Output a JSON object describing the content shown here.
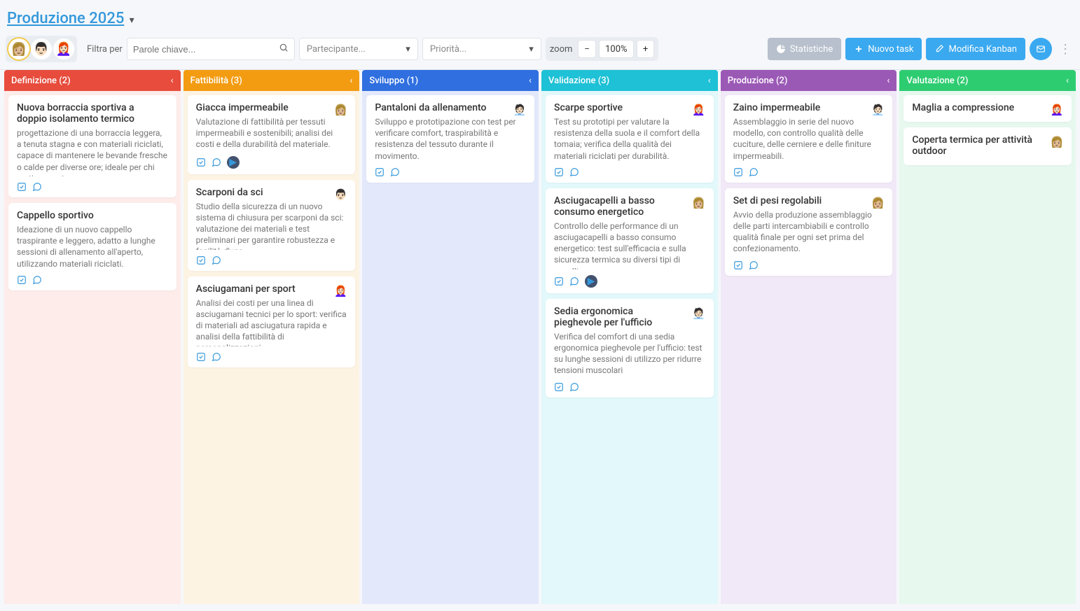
{
  "board_title": "Produzione 2025",
  "toolbar": {
    "filter_label": "Filtra per",
    "keyword_placeholder": "Parole chiave...",
    "participant_placeholder": "Partecipante...",
    "priority_placeholder": "Priorità...",
    "zoom_label": "zoom",
    "zoom_value": "100%",
    "stats_label": "Statistiche",
    "new_task_label": "Nuovo task",
    "edit_kanban_label": "Modifica Kanban"
  },
  "avatars": {
    "top": [
      "blonde-woman",
      "man-short",
      "redhead-woman"
    ]
  },
  "columns": [
    {
      "title": "Definizione (2)",
      "cards": [
        {
          "title": "Nuova borraccia sportiva a doppio isolamento termico",
          "desc": "progettazione di una borraccia leggera, a tenuta stagna e con materiali riciclati, capace di mantenere le bevande fresche o calde per diverse ore; ideale per chi pratica sport",
          "avatar": null,
          "play": false
        },
        {
          "title": "Cappello sportivo",
          "desc": "Ideazione di un nuovo cappello traspirante e leggero, adatto a lunghe sessioni di allenamento all'aperto, utilizzando materiali riciclati.",
          "avatar": null,
          "play": false
        }
      ]
    },
    {
      "title": "Fattibilità (3)",
      "cards": [
        {
          "title": "Giacca impermeabile",
          "desc": "Valutazione di fattibilità per tessuti impermeabili e sostenibili; analisi dei costi e della durabilità del materiale.",
          "avatar": "blonde-woman",
          "play": true
        },
        {
          "title": "Scarponi da sci",
          "desc": "Studio della sicurezza di un nuovo sistema di chiusura per scarponi da sci: valutazione dei materiali e test preliminari per garantire robustezza e facilità d'uso",
          "avatar": "man-short",
          "play": false
        },
        {
          "title": "Asciugamani per sport",
          "desc": "Analisi dei costi per una linea di asciugamani tecnici per lo sport: verifica di materiali ad asciugatura rapida e analisi della fattibilità di personalizzazioni",
          "avatar": "redhead-woman",
          "play": false
        }
      ]
    },
    {
      "title": "Sviluppo (1)",
      "cards": [
        {
          "title": "Pantaloni da allenamento",
          "desc": "Sviluppo e prototipazione con test per verificare comfort, traspirabilità e resistenza del tessuto durante il movimento.",
          "avatar": "man-glasses",
          "play": false
        }
      ]
    },
    {
      "title": "Validazione (3)",
      "cards": [
        {
          "title": "Scarpe sportive",
          "desc": "Test su prototipi per valutare la resistenza della suola e il comfort della tomaia; verifica della qualità dei materiali riciclati per durabilità.",
          "avatar": "redhead-woman",
          "play": false
        },
        {
          "title": "Asciugacapelli a basso consumo energetico",
          "desc": "Controllo delle performance di un asciugacapelli a basso consumo energetico: test sull'efficacia e sulla sicurezza termica su diversi tipi di capelli",
          "avatar": "blonde-woman",
          "play": true
        },
        {
          "title": "Sedia ergonomica pieghevole per l'ufficio",
          "desc": "Verifica del comfort di una sedia ergonomica pieghevole per l'ufficio: test su lunghe sessioni di utilizzo per ridurre tensioni muscolari",
          "avatar": "man-glasses",
          "play": false
        }
      ]
    },
    {
      "title": "Produzione (2)",
      "cards": [
        {
          "title": "Zaino impermeabile",
          "desc": "Assemblaggio in serie del nuovo modello, con controllo qualità delle cuciture, delle cerniere e delle finiture impermeabili.",
          "avatar": "man-glasses",
          "play": false
        },
        {
          "title": "Set di pesi regolabili",
          "desc": "Avvio della produzione assemblaggio delle parti intercambiabili e controllo qualità finale per ogni set prima del confezionamento.",
          "avatar": "blonde-woman",
          "play": false
        }
      ]
    },
    {
      "title": "Valutazione (2)",
      "cards": [
        {
          "title": "Maglia a compressione",
          "desc": "",
          "avatar": "redhead-woman",
          "play": false
        },
        {
          "title": "Coperta termica per attività outdoor",
          "desc": "",
          "avatar": "blonde-woman",
          "play": false
        }
      ]
    }
  ]
}
